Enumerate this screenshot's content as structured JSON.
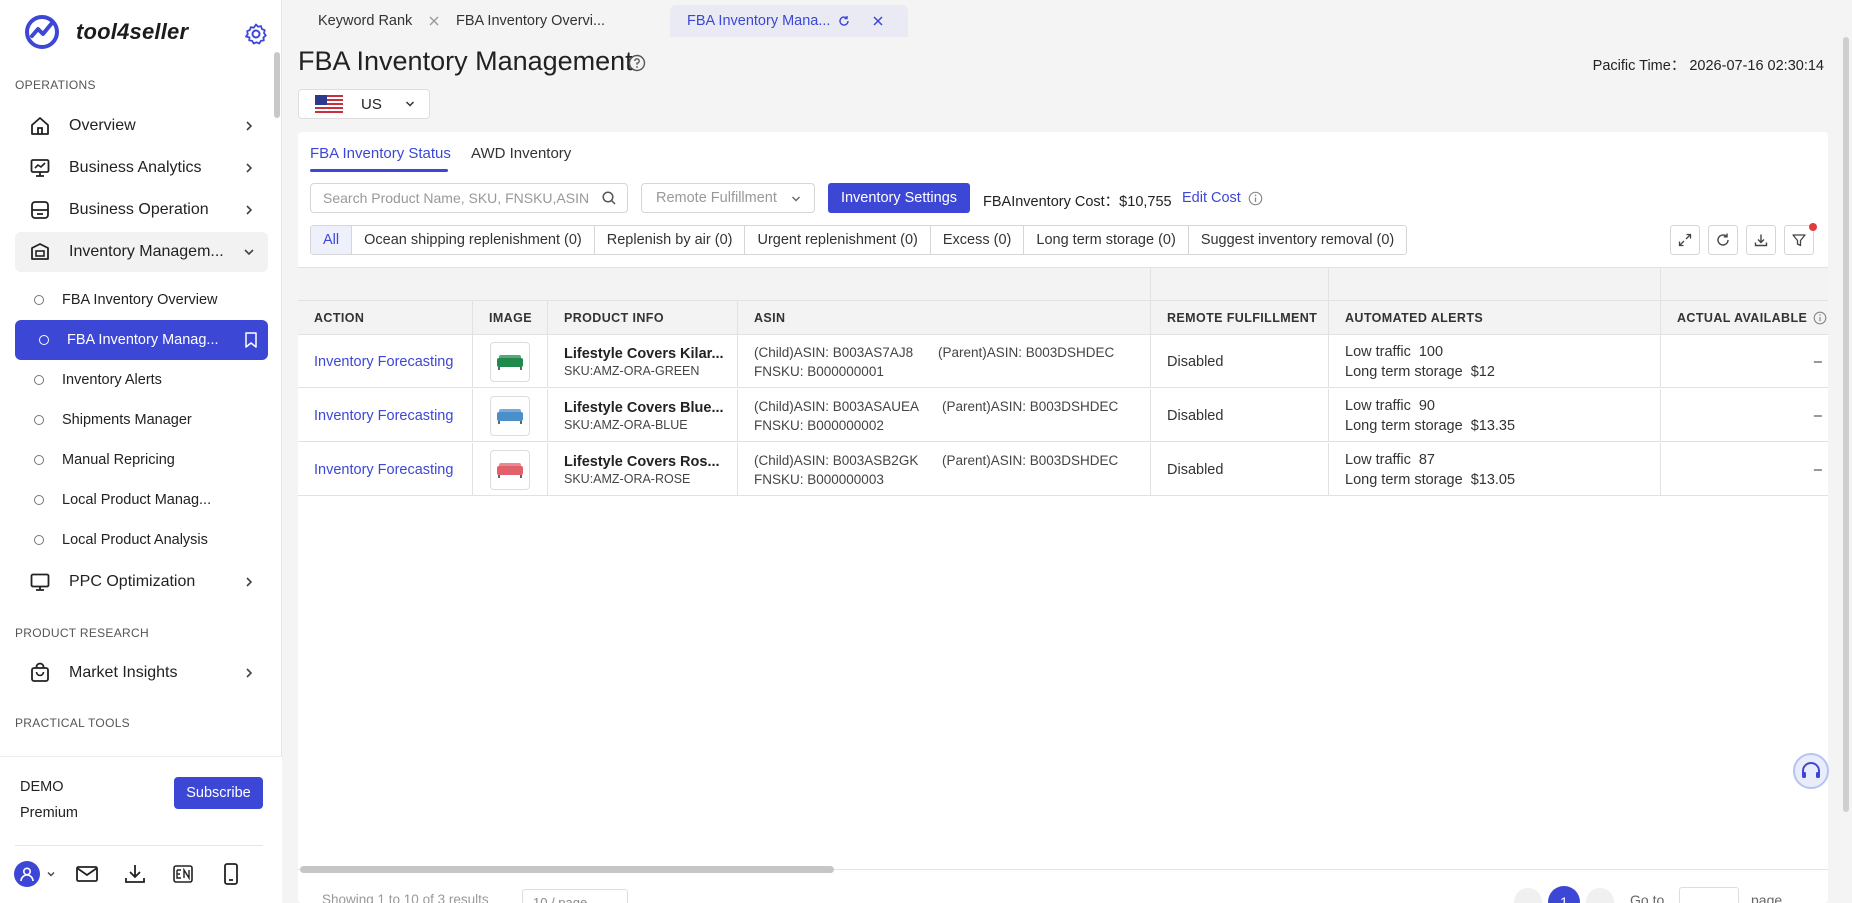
{
  "app": {
    "name": "tool4seller"
  },
  "sidebar": {
    "sections": {
      "operations": "OPERATIONS",
      "product_research": "PRODUCT RESEARCH",
      "practical_tools": "PRACTICAL TOOLS"
    },
    "items": {
      "overview": "Overview",
      "business_analytics": "Business Analytics",
      "business_operation": "Business Operation",
      "inventory_management": "Inventory Managem...",
      "ppc_optimization": "PPC Optimization",
      "market_insights": "Market Insights"
    },
    "sub_items": [
      "FBA Inventory Overview",
      "FBA Inventory Manag...",
      "Inventory Alerts",
      "Shipments Manager",
      "Manual Repricing",
      "Local Product Manag...",
      "Local Product Analysis"
    ],
    "account": {
      "name": "DEMO",
      "plan": "Premium",
      "subscribe_label": "Subscribe"
    }
  },
  "tabs": [
    {
      "label": "Keyword Rank"
    },
    {
      "label": "FBA Inventory Overvi..."
    },
    {
      "label": "FBA Inventory Mana..."
    }
  ],
  "page": {
    "title": "FBA Inventory Management",
    "pacific_time": "Pacific Time： 2026-07-16 02:30:14",
    "country": "US"
  },
  "subtabs": [
    "FBA Inventory Status",
    "AWD Inventory"
  ],
  "toolbar": {
    "search_placeholder": "Search Product Name, SKU, FNSKU,ASIN",
    "remote_fulfillment_placeholder": "Remote Fulfillment",
    "inventory_settings_label": "Inventory Settings",
    "cost_text": "FBAInventory Cost：$10,755",
    "edit_cost_label": "Edit Cost"
  },
  "filters": [
    "All",
    "Ocean shipping replenishment (0)",
    "Replenish by air (0)",
    "Urgent replenishment (0)",
    "Excess (0)",
    "Long term storage (0)",
    "Suggest inventory removal (0)"
  ],
  "table": {
    "headers": [
      "ACTION",
      "IMAGE",
      "PRODUCT INFO",
      "ASIN",
      "REMOTE FULFILLMENT",
      "AUTOMATED ALERTS",
      "ACTUAL AVAILABLE"
    ],
    "rows": [
      {
        "action": "Inventory Forecasting",
        "product_name": "Lifestyle Covers Kilar...",
        "sku": "SKU:AMZ-ORA-GREEN",
        "child_asin": "(Child)ASIN: B003AS7AJ8",
        "parent_asin": "(Parent)ASIN: B003DSHDEC",
        "fnsku": "FNSKU: B000000001",
        "remote": "Disabled",
        "traffic_label": "Low traffic",
        "traffic_value": "100",
        "storage_label": "Long term storage",
        "storage_value": "$12",
        "available": "–",
        "color": "#1f8a4c"
      },
      {
        "action": "Inventory Forecasting",
        "product_name": "Lifestyle Covers Blue...",
        "sku": "SKU:AMZ-ORA-BLUE",
        "child_asin": "(Child)ASIN: B003ASAUEA",
        "parent_asin": "(Parent)ASIN: B003DSHDEC",
        "fnsku": "FNSKU: B000000002",
        "remote": "Disabled",
        "traffic_label": "Low traffic",
        "traffic_value": "90",
        "storage_label": "Long term storage",
        "storage_value": "$13.35",
        "available": "–",
        "color": "#4b8fc9"
      },
      {
        "action": "Inventory Forecasting",
        "product_name": "Lifestyle Covers Ros...",
        "sku": "SKU:AMZ-ORA-ROSE",
        "child_asin": "(Child)ASIN: B003ASB2GK",
        "parent_asin": "(Parent)ASIN: B003DSHDEC",
        "fnsku": "FNSKU: B000000003",
        "remote": "Disabled",
        "traffic_label": "Low traffic",
        "traffic_value": "87",
        "storage_label": "Long term storage",
        "storage_value": "$13.05",
        "available": "–",
        "color": "#e2606a"
      }
    ]
  },
  "pagination": {
    "showing": "Showing 1 to 10 of 3 results",
    "page_size": "10 / page",
    "current": "1",
    "goto_label": "Go to",
    "page_word": "page"
  },
  "colors": {
    "accent": "#3d47d6"
  }
}
